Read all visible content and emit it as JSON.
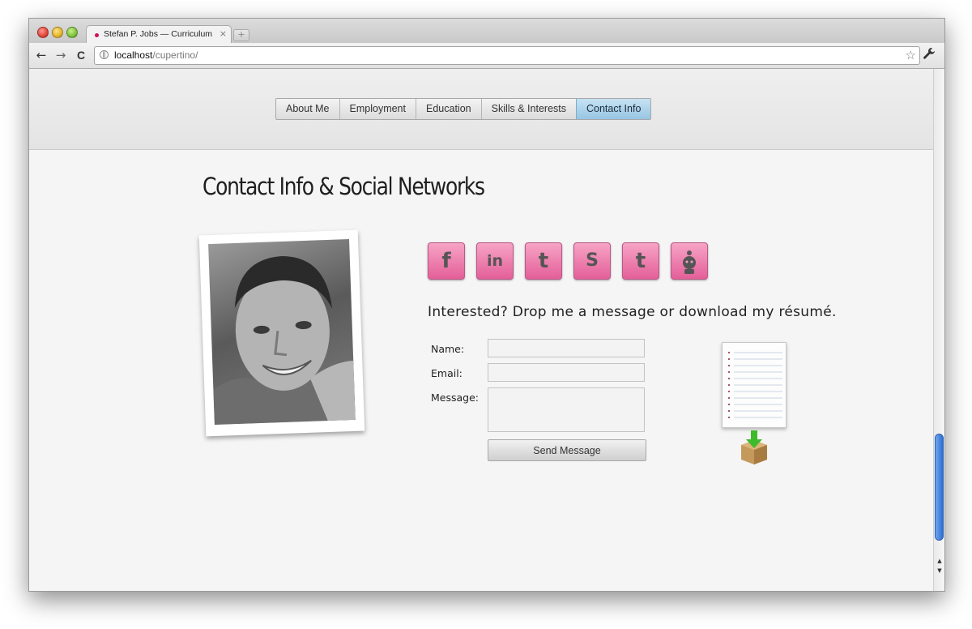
{
  "browser": {
    "tab_title": "Stefan P. Jobs — Curriculum",
    "tab_close": "×",
    "new_tab": "+",
    "url_host": "localhost",
    "url_path": "/cupertino/"
  },
  "toolbar": {
    "back": "←",
    "forward": "→",
    "reload": "C",
    "bookmark": "☆",
    "settings": "🔧"
  },
  "nav": {
    "items": [
      {
        "label": "About Me",
        "active": false
      },
      {
        "label": "Employment",
        "active": false
      },
      {
        "label": "Education",
        "active": false
      },
      {
        "label": "Skills & Interests",
        "active": false
      },
      {
        "label": "Contact Info",
        "active": true
      }
    ]
  },
  "page": {
    "title": "Contact Info & Social Networks",
    "tagline": "Interested? Drop me a message or download my résumé."
  },
  "social": [
    {
      "name": "facebook-icon",
      "glyph": "f"
    },
    {
      "name": "linkedin-icon",
      "glyph": "in"
    },
    {
      "name": "twitter-icon",
      "glyph": "t"
    },
    {
      "name": "skype-icon",
      "glyph": "S"
    },
    {
      "name": "tumblr-icon",
      "glyph": "t"
    },
    {
      "name": "reddit-icon",
      "glyph": ""
    }
  ],
  "form": {
    "name_label": "Name:",
    "email_label": "Email:",
    "message_label": "Message:",
    "name_value": "",
    "email_value": "",
    "message_value": "",
    "send_label": "Send Message"
  },
  "colors": {
    "accent": "#97c5e3",
    "social_pink": "#e35f98",
    "scroll_thumb": "#2f6fd0"
  }
}
